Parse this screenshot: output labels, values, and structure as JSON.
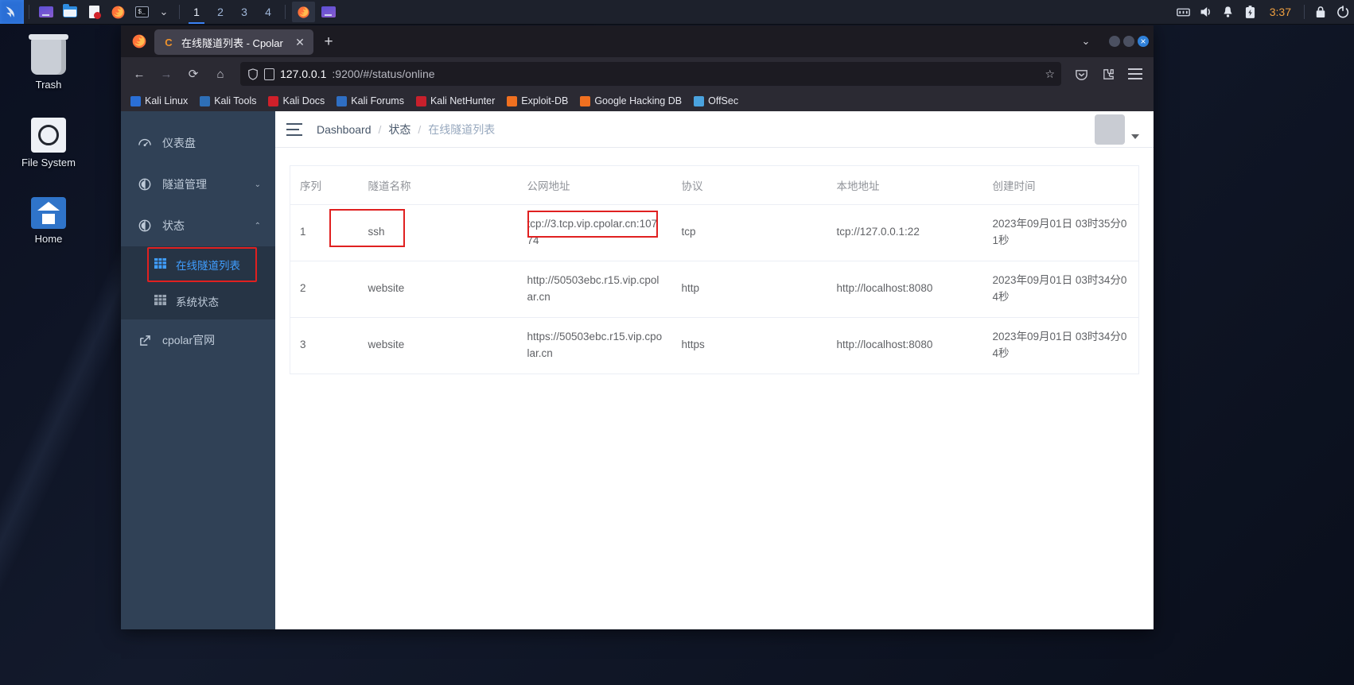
{
  "taskbar": {
    "launchers": [
      {
        "name": "kali-menu-icon",
        "label": ""
      },
      {
        "name": "files-icon",
        "label": ""
      },
      {
        "name": "folder-icon",
        "label": ""
      },
      {
        "name": "document-icon",
        "label": ""
      },
      {
        "name": "firefox-icon",
        "label": ""
      },
      {
        "name": "terminal-icon",
        "label": "$_"
      }
    ],
    "workspaces": [
      "1",
      "2",
      "3",
      "4"
    ],
    "active_workspace": "1",
    "window_buttons": [
      {
        "name": "firefox-window-button",
        "label": ""
      },
      {
        "name": "file-window-button",
        "label": ""
      }
    ],
    "tray": {
      "network_icon": "network-icon",
      "volume_icon": "volume-icon",
      "notification_icon": "bell-icon",
      "battery_icon": "battery-icon",
      "clock": "3:37",
      "lock_icon": "lock-icon",
      "power_icon": "power-icon"
    }
  },
  "desktop_icons": [
    {
      "name": "trash",
      "label": "Trash"
    },
    {
      "name": "file-system",
      "label": "File System"
    },
    {
      "name": "home",
      "label": "Home"
    }
  ],
  "browser": {
    "tab": {
      "favicon_letter": "C",
      "title": "在线隧道列表 - Cpolar",
      "close_label": "✕"
    },
    "new_tab_label": "+",
    "list_all_tabs_label": "⌄",
    "window_controls": {
      "minimize": "",
      "maximize": "",
      "close": ""
    },
    "nav": {
      "back": "←",
      "forward": "→",
      "reload": "⟳",
      "home": "⌂"
    },
    "url": {
      "host": "127.0.0.1",
      "rest": ":9200/#/status/online",
      "bookmark_star": "☆"
    },
    "toolbar_right": {
      "pocket": "pocket-icon",
      "extensions": "extensions-icon",
      "menu": "menu-icon"
    },
    "bookmarks": [
      {
        "label": "Kali Linux",
        "icon": "kali-linux-icon"
      },
      {
        "label": "Kali Tools",
        "icon": "kali-tools-icon"
      },
      {
        "label": "Kali Docs",
        "icon": "kali-docs-icon"
      },
      {
        "label": "Kali Forums",
        "icon": "kali-forums-icon"
      },
      {
        "label": "Kali NetHunter",
        "icon": "kali-nethunter-icon"
      },
      {
        "label": "Exploit-DB",
        "icon": "exploit-db-icon"
      },
      {
        "label": "Google Hacking DB",
        "icon": "google-hacking-db-icon"
      },
      {
        "label": "OffSec",
        "icon": "offsec-icon"
      }
    ]
  },
  "sidebar": {
    "items": [
      {
        "label": "仪表盘",
        "icon": "dashboard-icon",
        "expandable": false
      },
      {
        "label": "隧道管理",
        "icon": "tunnel-icon",
        "expandable": true,
        "chevron": "⌄"
      },
      {
        "label": "状态",
        "icon": "status-icon",
        "expandable": true,
        "chevron": "⌃"
      }
    ],
    "sub_items": [
      {
        "label": "在线隧道列表",
        "icon": "table-icon",
        "active": true
      },
      {
        "label": "系统状态",
        "icon": "grid-icon",
        "active": false
      }
    ],
    "external": {
      "label": "cpolar官网",
      "icon": "external-link-icon"
    }
  },
  "header": {
    "menu_toggle": "hamburger-icon",
    "breadcrumb": [
      "Dashboard",
      "状态",
      "在线隧道列表"
    ],
    "separator": "/",
    "avatar": "user-avatar",
    "dropdown_caret": "▾"
  },
  "table": {
    "columns": [
      "序列",
      "隧道名称",
      "公网地址",
      "协议",
      "本地地址",
      "创建时间"
    ],
    "rows": [
      {
        "seq": "1",
        "name": "ssh",
        "public_url": "tcp://3.tcp.vip.cpolar.cn:10774",
        "protocol": "tcp",
        "local_url": "tcp://127.0.0.1:22",
        "created": "2023年09月01日 03时35分01秒"
      },
      {
        "seq": "2",
        "name": "website",
        "public_url": "http://50503ebc.r15.vip.cpolar.cn",
        "protocol": "http",
        "local_url": "http://localhost:8080",
        "created": "2023年09月01日 03时34分04秒"
      },
      {
        "seq": "3",
        "name": "website",
        "public_url": "https://50503ebc.r15.vip.cpolar.cn",
        "protocol": "https",
        "local_url": "http://localhost:8080",
        "created": "2023年09月01日 03时34分04秒"
      }
    ]
  },
  "annotations": {
    "highlight_color": "#e02020",
    "boxes": [
      "sidebar-online-tunnel-list",
      "row1-tunnel-name",
      "row1-public-address"
    ]
  }
}
